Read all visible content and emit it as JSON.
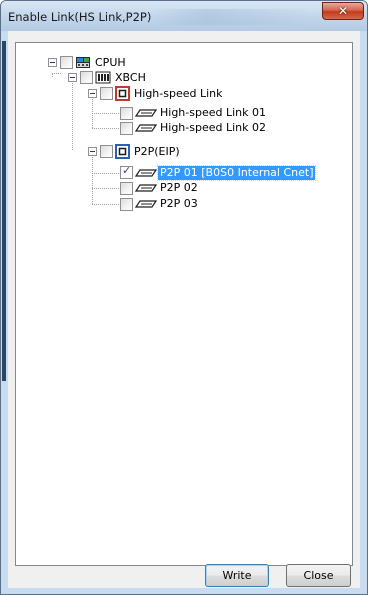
{
  "window": {
    "title": "Enable Link(HS Link,P2P)",
    "close_glyph": "✕"
  },
  "tree": {
    "nodes": [
      {
        "label": "CPUH",
        "checked": false,
        "icon": "cpu-module-icon"
      },
      {
        "label": "XBCH",
        "checked": false,
        "icon": "plc-module-icon"
      },
      {
        "label": "High-speed Link",
        "checked": false,
        "icon": "high-speed-link-group-icon"
      },
      {
        "label": "High-speed Link 01",
        "checked": false,
        "icon": "link-block-icon"
      },
      {
        "label": "High-speed Link 02",
        "checked": false,
        "icon": "link-block-icon"
      },
      {
        "label": "P2P(EIP)",
        "checked": false,
        "icon": "p2p-group-icon"
      },
      {
        "label": "P2P 01 [B0S0 Internal Cnet]",
        "checked": true,
        "selected": true,
        "icon": "link-block-icon"
      },
      {
        "label": "P2P 02",
        "checked": false,
        "icon": "link-block-icon"
      },
      {
        "label": "P2P 03",
        "checked": false,
        "icon": "link-block-icon"
      }
    ]
  },
  "buttons": {
    "write": "Write",
    "close": "Close"
  },
  "colors": {
    "selection": "#3399ff",
    "title_bar": "#c1d5ea",
    "close_button": "#c23b1c",
    "group_icon_red": "#c0392b",
    "group_icon_blue": "#2f5fb3"
  }
}
